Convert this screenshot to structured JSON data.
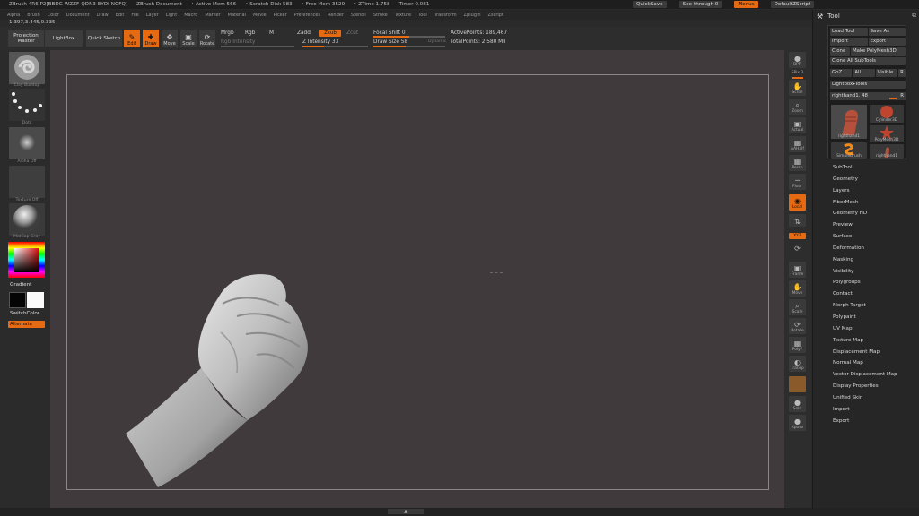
{
  "titlebar": {
    "items": [
      "ZBrush 4R6 P2[BBDG-WZZF-QDN3-EYDI-NGFQ]",
      "ZBrush Document",
      "• Active Mem 566",
      "• Scratch Disk 583",
      "• Free Mem 3529",
      "• ZTime 1.758",
      "Timer 0.081"
    ],
    "quicksave": "QuickSave",
    "see_through": "See-through 0",
    "menus_btn": "Menus",
    "default_script": "DefaultZScript"
  },
  "menubar": {
    "items": [
      "Alpha",
      "Brush",
      "Color",
      "Document",
      "Draw",
      "Edit",
      "File",
      "Layer",
      "Light",
      "Macro",
      "Marker",
      "Material",
      "Movie",
      "Picker",
      "Preferences",
      "Render",
      "Stencil",
      "Stroke",
      "Texture",
      "Tool",
      "Transform",
      "Zplugin",
      "Zscript"
    ]
  },
  "coords": "1.397,3.445,0.335",
  "toolbar": {
    "projection_master": "Projection Master",
    "lightbox": "LightBox",
    "quick_sketch": "Quick Sketch",
    "edit": "Edit",
    "draw": "Draw",
    "move": "Move",
    "scale": "Scale",
    "rotate": "Rotate",
    "mrgb": "Mrgb",
    "rgb": "Rgb",
    "m": "M",
    "zadd": "Zadd",
    "zsub": "Zsub",
    "zcut": "Zcut",
    "rgb_intensity": "Rgb Intensity",
    "z_intensity": "Z Intensity 33",
    "focal_shift": "Focal Shift 0",
    "draw_size": "Draw Size 58",
    "dynamic": "Dynamic",
    "active_points": "ActivePoints: 189,467",
    "total_points": "TotalPoints: 2.580 Mil",
    "z_intensity_level": 0.33,
    "focal_shift_level": 0.5,
    "draw_size_level": 0.45
  },
  "left_shelf": {
    "brush_label": "Clay Buildup",
    "stroke_label": "Dots",
    "alpha_label": "Alpha Off",
    "texture_label": "Texture Off",
    "material_label": "MatCap Gray",
    "gradient": "Gradient",
    "switch_color": "SwitchColor",
    "alternate": "Alternate"
  },
  "right_shelf": {
    "bpr": "BPR",
    "spix": "SPix 3",
    "scroll": "Scroll",
    "zoom": "Zoom",
    "actual": "Actual",
    "aahalf": "AAHalf",
    "persp": "Persp",
    "floor": "Floor",
    "local": "Local",
    "xyz": "XYZ",
    "frame": "Frame",
    "move": "Move",
    "scale": "Scale",
    "rotate": "Rotate",
    "polyf": "PolyF",
    "transp": "Transp",
    "solo": "Solo",
    "xpose": "Xpose"
  },
  "tool_panel": {
    "title": "Tool",
    "load_tool": "Load Tool",
    "save_as": "Save As",
    "import": "Import",
    "export": "Export",
    "clone": "Clone",
    "make_polymesh": "Make PolyMesh3D",
    "clone_all": "Clone All SubTools",
    "goz": "GoZ",
    "all": "All",
    "visible": "Visible",
    "r": "R",
    "lightbox_tools": "Lightbox▸Tools",
    "current_tool": "righthand1. 48",
    "thumbs": [
      "righthand1",
      "Cylinder3D",
      "PolyMesh3D",
      "SimpleBrush",
      "righthand1"
    ],
    "sections": [
      "SubTool",
      "Geometry",
      "Layers",
      "FiberMesh",
      "Geometry HD",
      "Preview",
      "Surface",
      "Deformation",
      "Masking",
      "Visibility",
      "Polygroups",
      "Contact",
      "Morph Target",
      "Polypaint",
      "UV Map",
      "Texture Map",
      "Displacement Map",
      "Normal Map",
      "Vector Displacement Map",
      "Display Properties",
      "Unified Skin",
      "Import",
      "Export"
    ]
  },
  "colors": {
    "accent": "#e66a12",
    "canvas": "#413a3c",
    "panel": "#262626"
  }
}
